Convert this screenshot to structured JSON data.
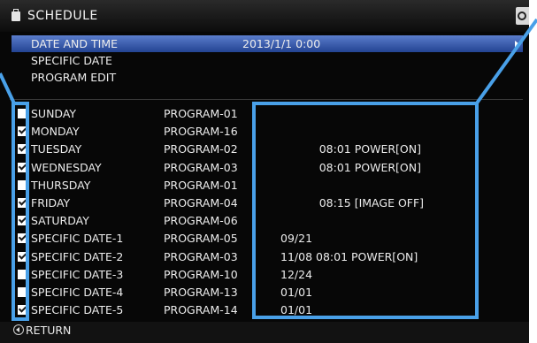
{
  "window": {
    "title": "SCHEDULE",
    "title_icon": "calendar-icon",
    "corner_icon": "power-icon"
  },
  "menu": [
    {
      "label": "DATE AND TIME",
      "value": "2013/1/1   0:00",
      "selected": true
    },
    {
      "label": "SPECIFIC DATE",
      "value": ""
    },
    {
      "label": "PROGRAM EDIT",
      "value": ""
    }
  ],
  "schedule": [
    {
      "checked": false,
      "day": "SUNDAY",
      "program": "PROGRAM-01",
      "info": ""
    },
    {
      "checked": true,
      "day": "MONDAY",
      "program": "PROGRAM-16",
      "info": ""
    },
    {
      "checked": true,
      "day": "TUESDAY",
      "program": "PROGRAM-02",
      "info": "           08:01 POWER[ON]"
    },
    {
      "checked": true,
      "day": "WEDNESDAY",
      "program": "PROGRAM-03",
      "info": "           08:01 POWER[ON]"
    },
    {
      "checked": false,
      "day": "THURSDAY",
      "program": "PROGRAM-01",
      "info": ""
    },
    {
      "checked": true,
      "day": "FRIDAY",
      "program": "PROGRAM-04",
      "info": "           08:15 [IMAGE OFF]"
    },
    {
      "checked": true,
      "day": "SATURDAY",
      "program": "PROGRAM-06",
      "info": ""
    },
    {
      "checked": true,
      "day": "SPECIFIC DATE-1",
      "program": "PROGRAM-05",
      "info": "09/21"
    },
    {
      "checked": true,
      "day": "SPECIFIC DATE-2",
      "program": "PROGRAM-03",
      "info": "11/08 08:01 POWER[ON]"
    },
    {
      "checked": false,
      "day": "SPECIFIC DATE-3",
      "program": "PROGRAM-10",
      "info": "12/24"
    },
    {
      "checked": false,
      "day": "SPECIFIC DATE-4",
      "program": "PROGRAM-13",
      "info": "01/01"
    },
    {
      "checked": true,
      "day": "SPECIFIC DATE-5",
      "program": "PROGRAM-14",
      "info": "01/01"
    }
  ],
  "footer": {
    "return_label": "RETURN",
    "return_icon": "return-arrow-icon"
  },
  "colors": {
    "selection": "#3a5fb5",
    "highlight": "#49a0e8",
    "background": "#070707"
  }
}
